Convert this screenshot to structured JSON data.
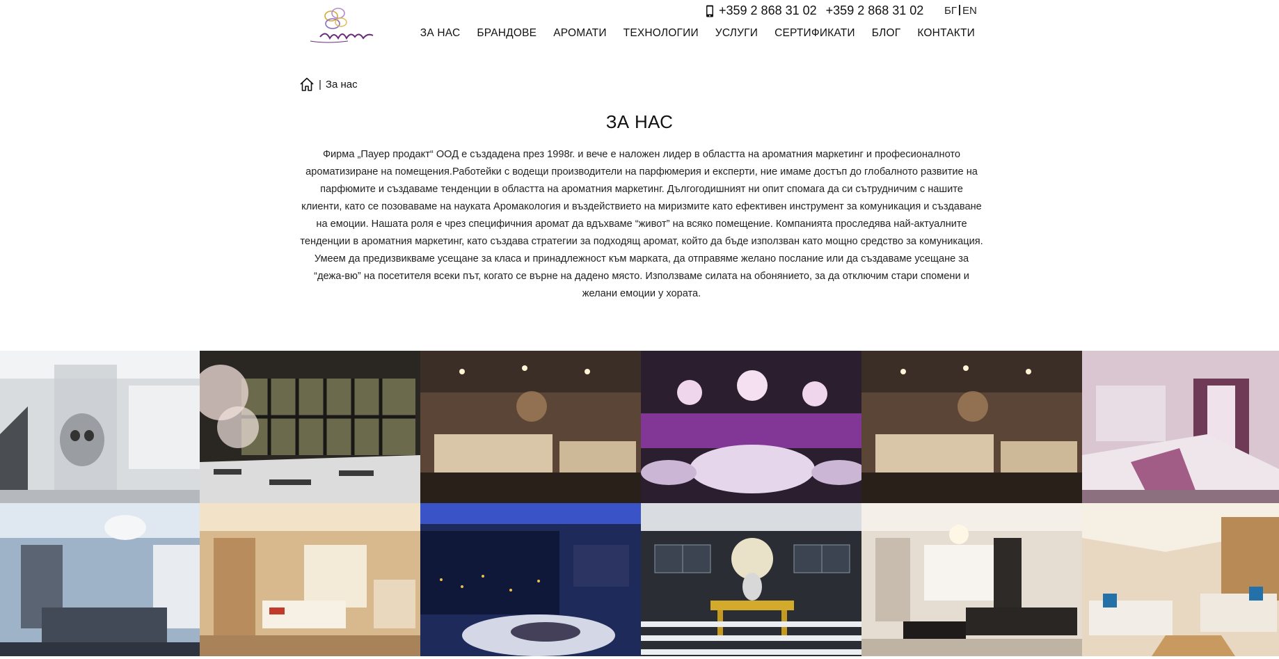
{
  "header": {
    "logo_alt": "Airlia",
    "phones": [
      "+359 2 868 31 02",
      "+359 2 868 31 02"
    ],
    "languages": [
      "БГ",
      "EN"
    ]
  },
  "nav": [
    "ЗА НАС",
    "БРАНДОВЕ",
    "АРОМАТИ",
    "ТЕХНОЛОГИИ",
    "УСЛУГИ",
    "СЕРТИФИКАТИ",
    "БЛОГ",
    "КОНТАКТИ"
  ],
  "breadcrumb": {
    "separator": "|",
    "current": "За нас"
  },
  "page": {
    "title": "ЗА НАС",
    "intro": "Фирма „Пауер продакт“ ООД е създадена през 1998г. и вече е наложен лидер в областта на ароматния маркетинг и професионалното ароматизиране на помещения.Работейки с водещи производители на парфюмерия и експерти, ние имаме достъп до глобалното развитие на парфюмите и създаваме тенденции в областта на ароматния маркетинг. Дългогодишният ни опит спомага да си сътрудничим с нашите клиенти, като се позоваваме на науката Аромакология и въздействието на миризмите като ефективен инструмент за комуникация и създаване на емоции. Нашата роля е чрез специфичния аромат да вдъхваме “живот” на всяко помещение. Компанията проследява най-актуалните тенденции в ароматния маркетинг, като създава стратегии за подходящ аромат, който да бъде използван като мощно средство за комуникация. Умеем да предизвикваме усещане за класа и принадлежност към марката, да отправяме желано послание или да създаваме усещане за “дежа-вю” на посетителя всеки път, когато се върне на дадено място.  Използваме силата на обонянието, за да отключим стари спомени и желани емоции у хората."
  },
  "gallery": {
    "photos": [
      {
        "name": "photo-boutique-skull"
      },
      {
        "name": "photo-blossom-hall"
      },
      {
        "name": "photo-lounge-gold"
      },
      {
        "name": "photo-purple-banquet"
      },
      {
        "name": "photo-lounge-gold-2"
      },
      {
        "name": "photo-pink-bedroom"
      },
      {
        "name": "photo-chandelier-livingroom"
      },
      {
        "name": "photo-beige-kitchen"
      },
      {
        "name": "photo-night-city-lounge"
      },
      {
        "name": "photo-lobby-flowers"
      },
      {
        "name": "photo-white-livingroom"
      },
      {
        "name": "photo-modern-lounge"
      }
    ]
  },
  "colors": {
    "accent": "#7a3f8f",
    "text": "#111111"
  }
}
